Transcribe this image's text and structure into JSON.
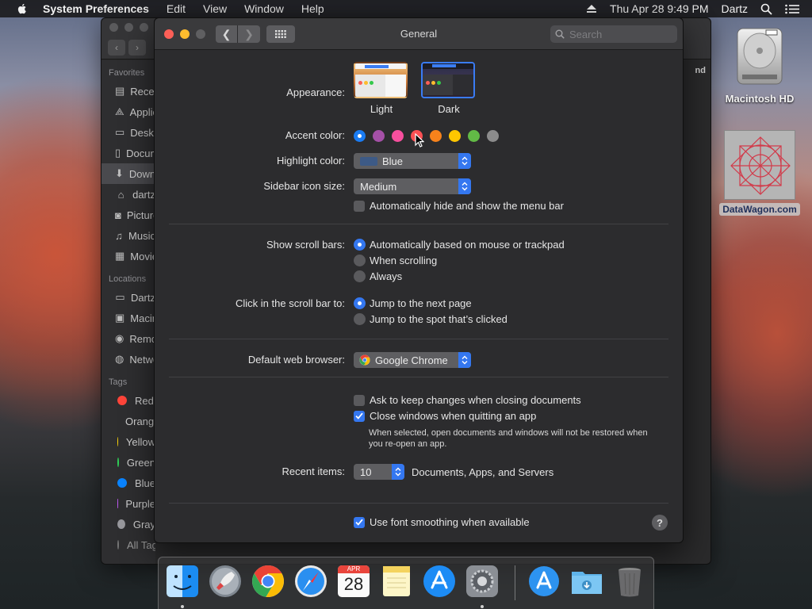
{
  "menubar": {
    "app_name": "System Preferences",
    "menus": [
      "Edit",
      "View",
      "Window",
      "Help"
    ],
    "datetime": "Thu Apr 28  9:49 PM",
    "user": "Dartz"
  },
  "finder": {
    "sections": {
      "favorites": "Favorites",
      "locations": "Locations",
      "tags": "Tags"
    },
    "favorites": [
      {
        "label": "Recents",
        "icon": "recents-icon"
      },
      {
        "label": "Applications",
        "icon": "applications-icon"
      },
      {
        "label": "Desktop",
        "icon": "desktop-icon"
      },
      {
        "label": "Documents",
        "icon": "documents-icon"
      },
      {
        "label": "Downloads",
        "icon": "downloads-icon"
      },
      {
        "label": "dartz",
        "icon": "home-icon"
      },
      {
        "label": "Pictures",
        "icon": "pictures-icon"
      },
      {
        "label": "Music",
        "icon": "music-icon"
      },
      {
        "label": "Movies",
        "icon": "movies-icon"
      }
    ],
    "locations": [
      {
        "label": "Dartz",
        "icon": "computer-icon"
      },
      {
        "label": "Macintosh HD",
        "icon": "disk-icon"
      },
      {
        "label": "Remote Disc",
        "icon": "disc-icon"
      },
      {
        "label": "Network",
        "icon": "network-icon"
      }
    ],
    "tags": [
      {
        "label": "Red",
        "color": "#ff453a"
      },
      {
        "label": "Orange",
        "color": "#ff9f0a"
      },
      {
        "label": "Yellow",
        "color": "#ffd60a"
      },
      {
        "label": "Green",
        "color": "#30d158"
      },
      {
        "label": "Blue",
        "color": "#0a84ff"
      },
      {
        "label": "Purple",
        "color": "#bf5af2"
      },
      {
        "label": "Gray",
        "color": "#98989d"
      }
    ],
    "all_tags": "All Tags...",
    "column_header": "nd"
  },
  "prefs": {
    "title": "General",
    "search_placeholder": "Search",
    "appearance": {
      "label": "Appearance:",
      "options": [
        "Light",
        "Dark"
      ],
      "selected": "Dark"
    },
    "accent": {
      "label": "Accent color:",
      "colors": [
        "#1a7cf3",
        "#a550a7",
        "#f74f9e",
        "#fc5053",
        "#f7821b",
        "#ffc600",
        "#62ba46",
        "#8c8c8c"
      ],
      "selected_index": 0
    },
    "highlight": {
      "label": "Highlight color:",
      "value": "Blue",
      "swatch": "#3d5a86"
    },
    "sidebar_size": {
      "label": "Sidebar icon size:",
      "value": "Medium"
    },
    "autohide_menubar": {
      "label": "Automatically hide and show the menu bar",
      "checked": false
    },
    "scroll_bars": {
      "label": "Show scroll bars:",
      "options": [
        "Automatically based on mouse or trackpad",
        "When scrolling",
        "Always"
      ],
      "selected_index": 0
    },
    "click_scroll": {
      "label": "Click in the scroll bar to:",
      "options": [
        "Jump to the next page",
        "Jump to the spot that’s clicked"
      ],
      "selected_index": 0
    },
    "browser": {
      "label": "Default web browser:",
      "value": "Google Chrome"
    },
    "ask_keep": {
      "label": "Ask to keep changes when closing documents",
      "checked": false
    },
    "close_windows": {
      "label": "Close windows when quitting an app",
      "checked": true
    },
    "note": "When selected, open documents and windows will not be restored when you re-open an app.",
    "recent": {
      "label": "Recent items:",
      "value": "10",
      "suffix": "Documents, Apps, and Servers"
    },
    "font_smoothing": {
      "label": "Use font smoothing when available",
      "checked": true
    },
    "help": "?"
  },
  "desktop": {
    "hd_label": "Macintosh HD",
    "dw_label": "DataWagon.com"
  },
  "dock": {
    "calendar_month": "APR",
    "calendar_day": "28"
  }
}
